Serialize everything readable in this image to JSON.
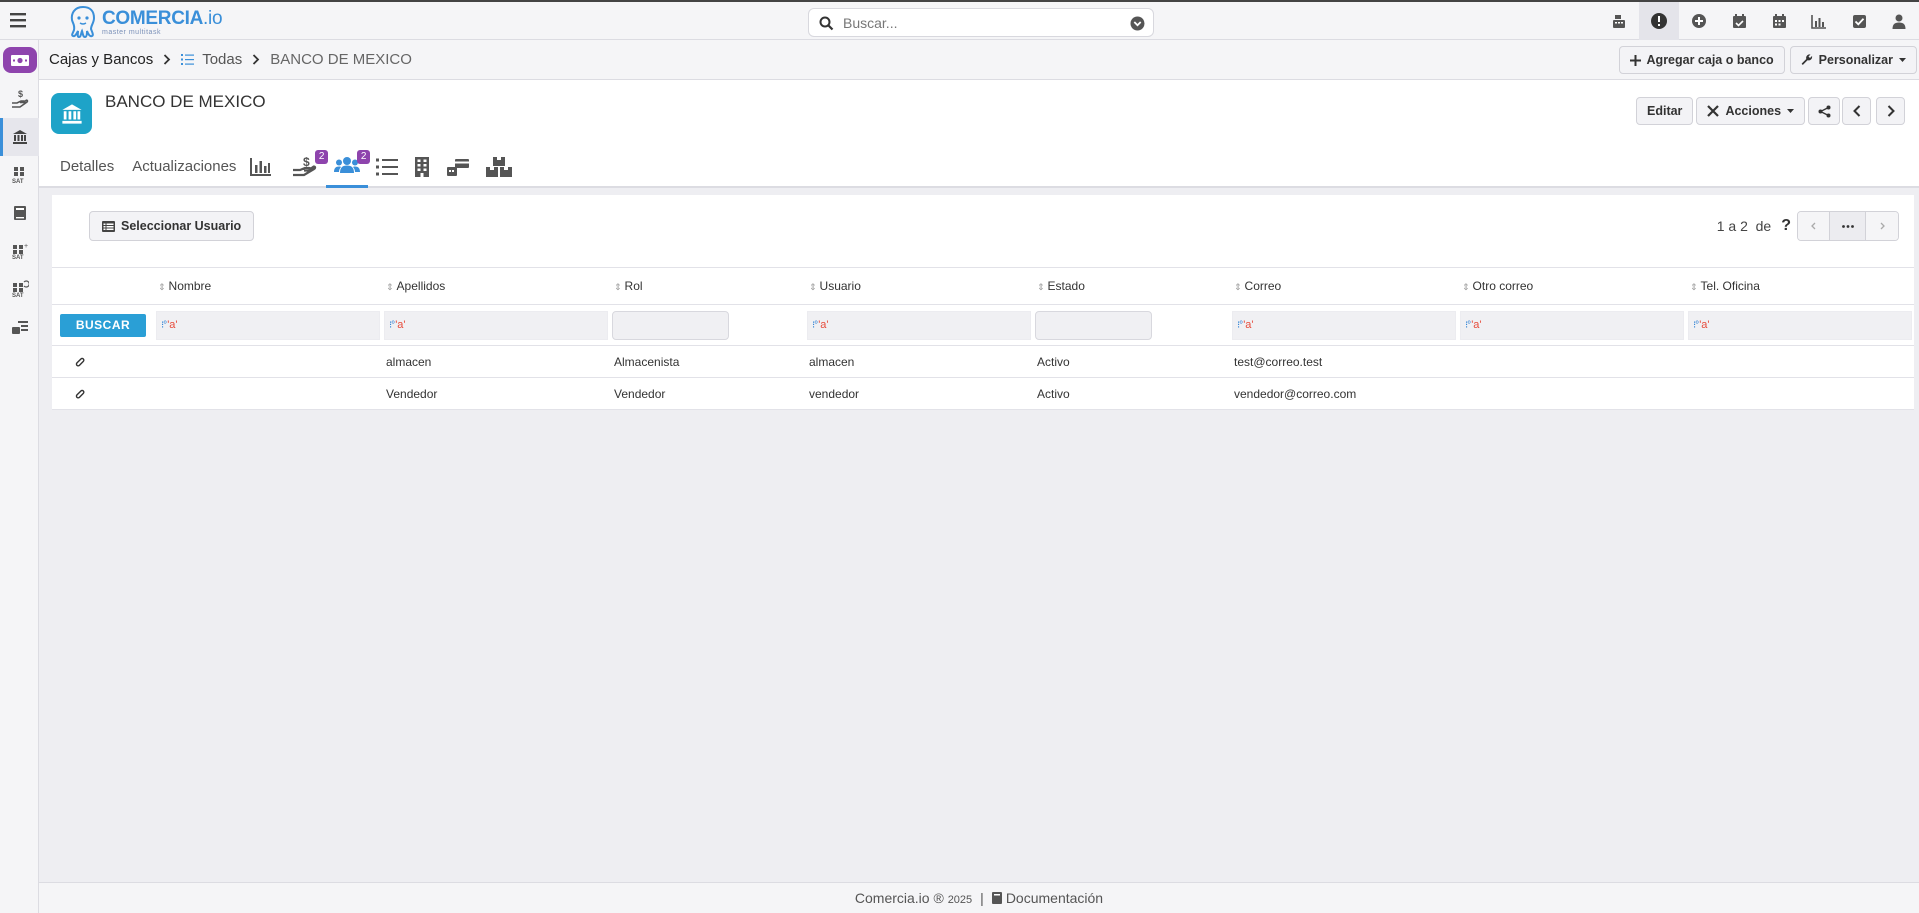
{
  "app": {
    "logo_main": "COMERCIA",
    "logo_io": ".io",
    "logo_tagline": "master multitask"
  },
  "search": {
    "placeholder": "Buscar..."
  },
  "top_icons": [
    "cash-register-icon",
    "alert-icon",
    "add-circle-icon",
    "calendar-check-icon",
    "calendar-icon",
    "chart-bar-icon",
    "checkbox-icon",
    "user-icon"
  ],
  "sidebar": {
    "items": [
      "cash-badge",
      "hand-money-icon",
      "bank-icon",
      "sat-group-icon",
      "book-icon",
      "sat-plus-icon",
      "sat-refresh-icon",
      "card-list-icon"
    ]
  },
  "breadcrumb": {
    "root": "Cajas y Bancos",
    "list": "Todas",
    "current": "BANCO DE MEXICO"
  },
  "crumb_actions": {
    "add": "Agregar caja o banco",
    "customize": "Personalizar"
  },
  "record": {
    "title": "BANCO DE MEXICO",
    "edit": "Editar",
    "actions": "Acciones"
  },
  "tabs": {
    "details": "Detalles",
    "updates": "Actualizaciones",
    "payments_badge": "2",
    "users_badge": "2"
  },
  "panel": {
    "select_user": "Seleccionar Usuario",
    "pager_text": "1 a 2  de",
    "pager_help": "?"
  },
  "table": {
    "columns": [
      "Nombre",
      "Apellidos",
      "Rol",
      "Usuario",
      "Estado",
      "Correo",
      "Otro correo",
      "Tel. Oficina"
    ],
    "search_button": "BUSCAR",
    "filter_text": "'a'",
    "rows": [
      {
        "nombre": "",
        "apellidos": "almacen",
        "rol": "Almacenista",
        "usuario": "almacen",
        "estado": "Activo",
        "correo": "test@correo.test",
        "otro_correo": "",
        "tel": ""
      },
      {
        "nombre": "",
        "apellidos": "Vendedor",
        "rol": "Vendedor",
        "usuario": "vendedor",
        "estado": "Activo",
        "correo": "vendedor@correo.com",
        "otro_correo": "",
        "tel": ""
      }
    ]
  },
  "footer": {
    "brand": "Comercia.io ®",
    "year": "2025",
    "sep": "|",
    "docs": "Documentación"
  },
  "colors": {
    "accent": "#3a8fd9",
    "badge": "#8e44ad",
    "bank": "#1ea3c8",
    "buscar": "#2a9fd6"
  }
}
